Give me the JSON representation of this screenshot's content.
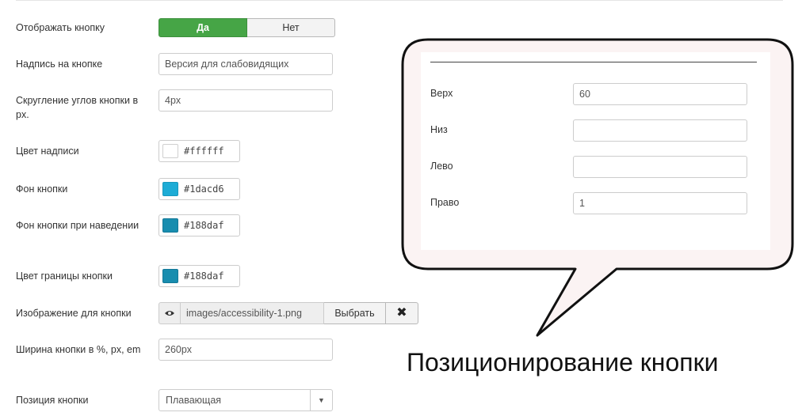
{
  "form": {
    "show_button": {
      "label": "Отображать кнопку",
      "yes": "Да",
      "no": "Нет",
      "selected": "Да"
    },
    "button_text": {
      "label": "Надпись на кнопке",
      "value": "Версия для слабовидящих"
    },
    "corner_radius": {
      "label": "Скругление углов кнопки в px.",
      "value": "4px"
    },
    "text_color": {
      "label": "Цвет надписи",
      "value": "#ffffff",
      "color": "#ffffff"
    },
    "bg_color": {
      "label": "Фон кнопки",
      "value": "#1dacd6",
      "color": "#1dacd6"
    },
    "hover_bg_color": {
      "label": "Фон кнопки при наведении",
      "value": "#188daf",
      "color": "#188daf"
    },
    "border_color": {
      "label": "Цвет границы кнопки",
      "value": "#188daf",
      "color": "#188daf"
    },
    "button_image": {
      "label": "Изображение для кнопки",
      "value": "images/accessibility-1.png",
      "select_label": "Выбрать",
      "preview_icon": "eye-icon",
      "clear_icon": "close-icon"
    },
    "button_width": {
      "label": "Ширина кнопки в %, px, em",
      "value": "260px"
    },
    "button_position": {
      "label": "Позиция кнопки",
      "value": "Плавающая"
    }
  },
  "callout": {
    "fields": [
      {
        "label": "Верх",
        "value": "60"
      },
      {
        "label": "Низ",
        "value": ""
      },
      {
        "label": "Лево",
        "value": ""
      },
      {
        "label": "Право",
        "value": "1"
      }
    ],
    "caption": "Позиционирование кнопки"
  },
  "colors": {
    "toggle_active": "#46a546",
    "bubble_fill": "#fbf3f3",
    "bubble_stroke": "#111111"
  }
}
